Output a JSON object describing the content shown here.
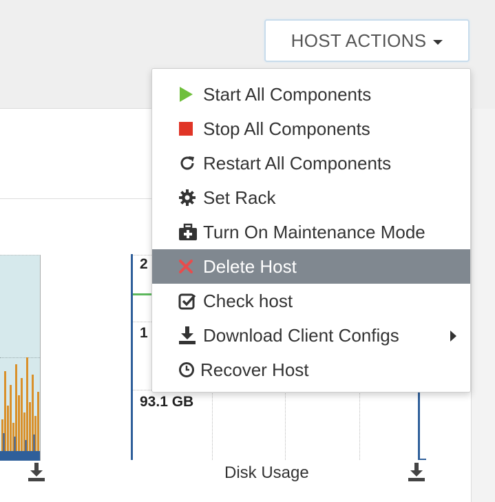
{
  "header": {
    "host_actions_label": "HOST ACTIONS"
  },
  "menu": {
    "items": [
      {
        "label": "Start All Components",
        "icon": "play-icon",
        "color": "#6fbf3b"
      },
      {
        "label": "Stop All Components",
        "icon": "stop-icon",
        "color": "#e03426"
      },
      {
        "label": "Restart All Components",
        "icon": "restart-icon"
      },
      {
        "label": "Set Rack",
        "icon": "gear-icon"
      },
      {
        "label": "Turn On Maintenance Mode",
        "icon": "medkit-icon"
      },
      {
        "label": "Delete Host",
        "icon": "close-icon",
        "color": "#e84c4c",
        "highlighted": true
      },
      {
        "label": "Check host",
        "icon": "check-square-icon"
      },
      {
        "label": "Download Client Configs",
        "icon": "download-icon",
        "has_submenu": true
      },
      {
        "label": "Recover Host",
        "icon": "clock-icon"
      }
    ]
  },
  "charts": {
    "disk_usage": {
      "title": "Disk Usage",
      "visible_y_labels": [
        "2",
        "1",
        "93.1 GB"
      ]
    }
  },
  "colors": {
    "accent_border": "#c8dcec",
    "highlight_bg": "#808890",
    "chart_fill": "#d6e9ec",
    "chart_bar": "#d9902a",
    "chart_line": "#2f5f9a",
    "chart_green": "#5cb85c"
  }
}
